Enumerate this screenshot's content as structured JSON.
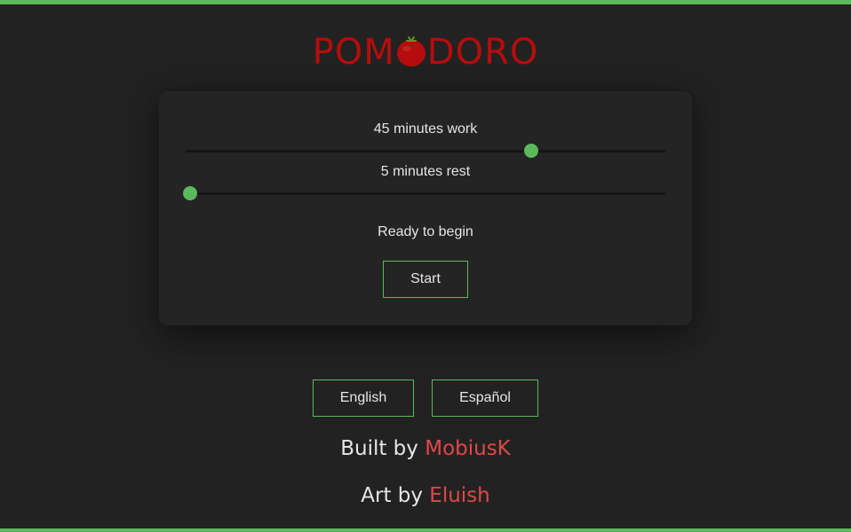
{
  "logo": {
    "left": "POM",
    "right": "DORO",
    "icon": "tomato-icon",
    "color": "#b50d0d"
  },
  "accent_color": "#5cb85c",
  "link_color": "#e04848",
  "timer": {
    "work_label": "45 minutes work",
    "work_minutes": 45,
    "work_fraction": 0.72,
    "rest_label": "5 minutes rest",
    "rest_minutes": 5,
    "rest_fraction": 0.01,
    "status": "Ready to begin",
    "start_label": "Start"
  },
  "languages": {
    "english": "English",
    "spanish": "Español"
  },
  "credits": {
    "built_prefix": "Built by",
    "built_name": "MobiusK",
    "art_prefix": "Art by",
    "art_name": "Eluish"
  }
}
